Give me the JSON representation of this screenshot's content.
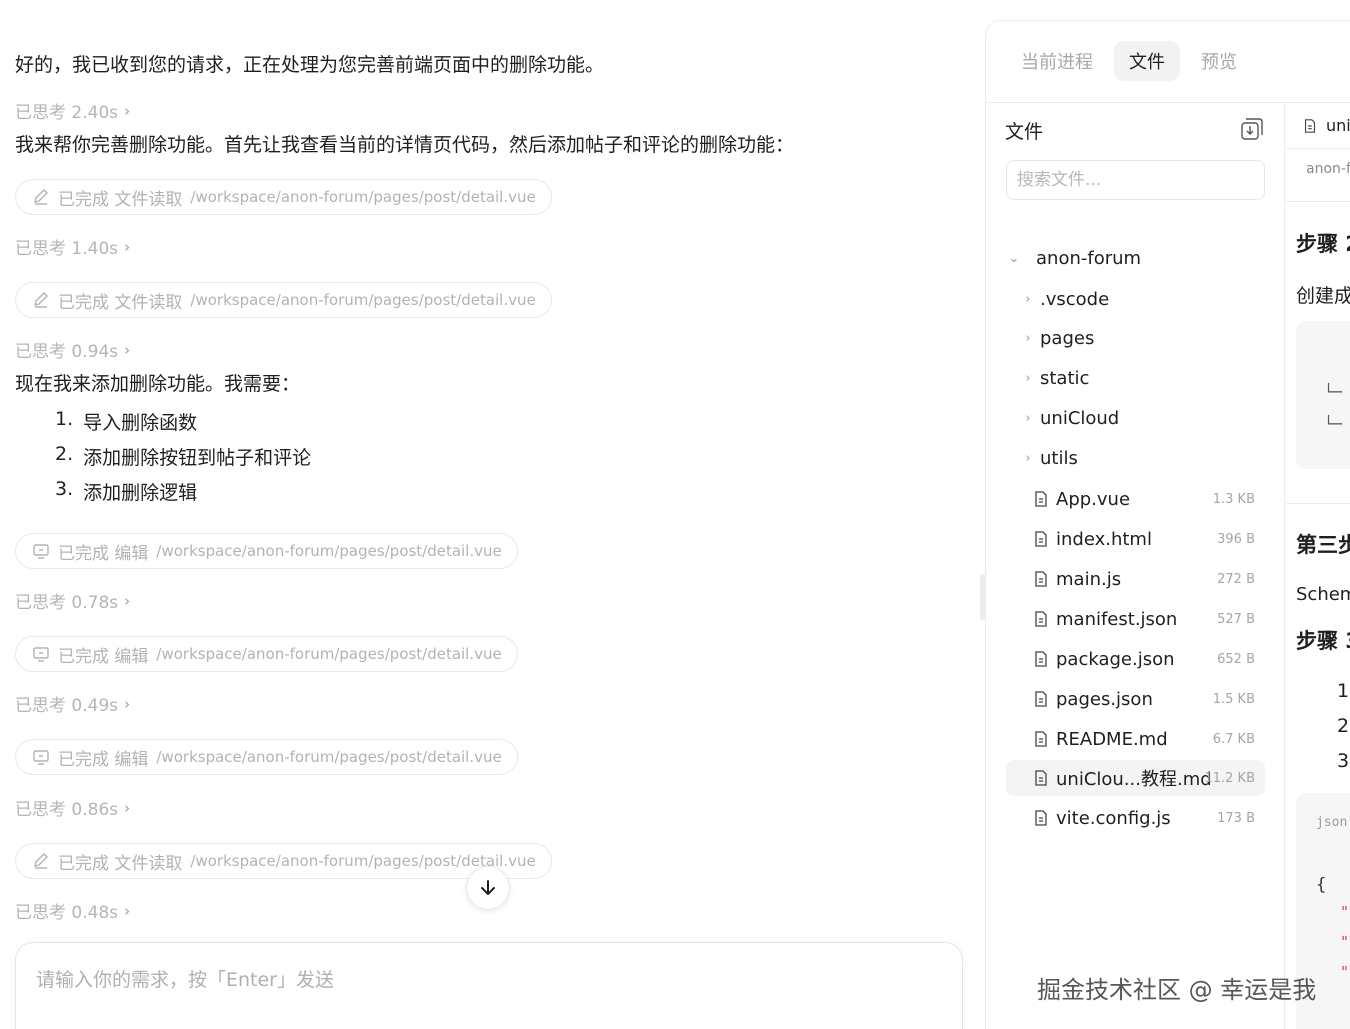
{
  "chat": {
    "intro": "好的，我已收到您的请求，正在处理为您完善前端页面中的删除功能。",
    "think_1": "已思考 2.40s",
    "plan": "我来帮你完善删除功能。首先让我查看当前的详情页代码，然后添加帖子和评论的删除功能：",
    "tool_1": {
      "status": "已完成 文件读取",
      "path": "/workspace/anon-forum/pages/post/detail.vue"
    },
    "think_2": "已思考 1.40s",
    "tool_2": {
      "status": "已完成 文件读取",
      "path": "/workspace/anon-forum/pages/post/detail.vue"
    },
    "think_3": "已思考 0.94s",
    "need": "现在我来添加删除功能。我需要：",
    "steps": [
      {
        "num": "1.",
        "text": "导入删除函数"
      },
      {
        "num": "2.",
        "text": "添加删除按钮到帖子和评论"
      },
      {
        "num": "3.",
        "text": "添加删除逻辑"
      }
    ],
    "tool_3": {
      "status": "已完成 编辑",
      "path": "/workspace/anon-forum/pages/post/detail.vue"
    },
    "think_4": "已思考 0.78s",
    "tool_4": {
      "status": "已完成 编辑",
      "path": "/workspace/anon-forum/pages/post/detail.vue"
    },
    "think_5": "已思考 0.49s",
    "tool_5": {
      "status": "已完成 编辑",
      "path": "/workspace/anon-forum/pages/post/detail.vue"
    },
    "think_6": "已思考 0.86s",
    "tool_6": {
      "status": "已完成 文件读取",
      "path": "/workspace/anon-forum/pages/post/detail.vue"
    },
    "think_7": "已思考 0.48s",
    "input_placeholder": "请输入你的需求，按「Enter」发送"
  },
  "panel": {
    "tabs": [
      "当前进程",
      "文件",
      "预览"
    ],
    "active_tab": "文件",
    "files_title": "文件",
    "search_placeholder": "搜索文件...",
    "root": "anon-forum",
    "folders": [
      ".vscode",
      "pages",
      "static",
      "uniCloud",
      "utils"
    ],
    "files": [
      {
        "name": "App.vue",
        "size": "1.3 KB"
      },
      {
        "name": "index.html",
        "size": "396 B"
      },
      {
        "name": "main.js",
        "size": "272 B"
      },
      {
        "name": "manifest.json",
        "size": "527 B"
      },
      {
        "name": "package.json",
        "size": "652 B"
      },
      {
        "name": "pages.json",
        "size": "1.5 KB"
      },
      {
        "name": "README.md",
        "size": "6.7 KB"
      },
      {
        "name": "uniClou...教程.md",
        "size": "11.2 KB"
      },
      {
        "name": "vite.config.js",
        "size": "173 B"
      }
    ],
    "selected_file": "uniClou...教程.md"
  },
  "preview": {
    "tab_label": "uni",
    "crumb": "anon-f",
    "heading_1": "步骤 2",
    "text_1": "创建成",
    "tree_1": "└─",
    "tree_2": "└─",
    "heading_2": "第三步",
    "text_2": "Schem",
    "heading_3": "步骤 3",
    "list": [
      "1.",
      "2.",
      "3."
    ],
    "code_lang": "json",
    "code_brace": "{",
    "code_q": [
      "\"",
      "\"",
      "\""
    ]
  },
  "watermark": "掘金技术社区 @ 幸运是我",
  "colors": {
    "accent_tab_bg": "#f2f2f2",
    "muted": "#b3b3b3",
    "code_string": "#e0443e"
  }
}
